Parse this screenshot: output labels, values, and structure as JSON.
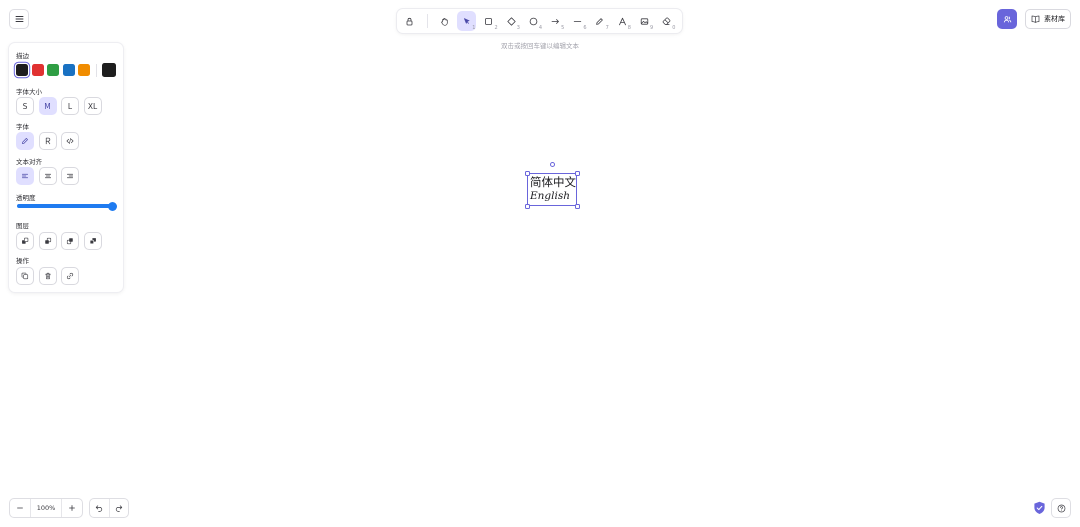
{
  "toolbar": {
    "tools": [
      {
        "name": "lock",
        "key": ""
      },
      {
        "name": "hand",
        "key": ""
      },
      {
        "name": "selection",
        "key": "1"
      },
      {
        "name": "rectangle",
        "key": "2"
      },
      {
        "name": "diamond",
        "key": "3"
      },
      {
        "name": "ellipse",
        "key": "4"
      },
      {
        "name": "arrow",
        "key": "5"
      },
      {
        "name": "line",
        "key": "6"
      },
      {
        "name": "draw",
        "key": "7"
      },
      {
        "name": "text",
        "key": "8"
      },
      {
        "name": "image",
        "key": "9"
      },
      {
        "name": "eraser",
        "key": "0"
      }
    ],
    "active_tool": "selection"
  },
  "hint": "双击或按回车键以编辑文本",
  "top_right": {
    "library_label": "素材库"
  },
  "panel": {
    "stroke_label": "描边",
    "stroke_colors": [
      "#1e1e1e",
      "#e03131",
      "#2f9e44",
      "#1971c2",
      "#f08c00"
    ],
    "stroke_current": "#1e1e1e",
    "font_size_label": "字体大小",
    "font_sizes": [
      "S",
      "M",
      "L",
      "XL"
    ],
    "font_size_active": "M",
    "font_family_label": "字体",
    "text_align_label": "文本对齐",
    "opacity_label": "透明度",
    "opacity_value": 100,
    "layers_label": "图层",
    "actions_label": "操作"
  },
  "canvas": {
    "text_line1": "简体中文",
    "text_line2": "English"
  },
  "footer": {
    "zoom": "100%"
  },
  "colors": {
    "accent": "#6965db",
    "accent_light": "#e0dfff",
    "slider": "#1f7bf0"
  }
}
